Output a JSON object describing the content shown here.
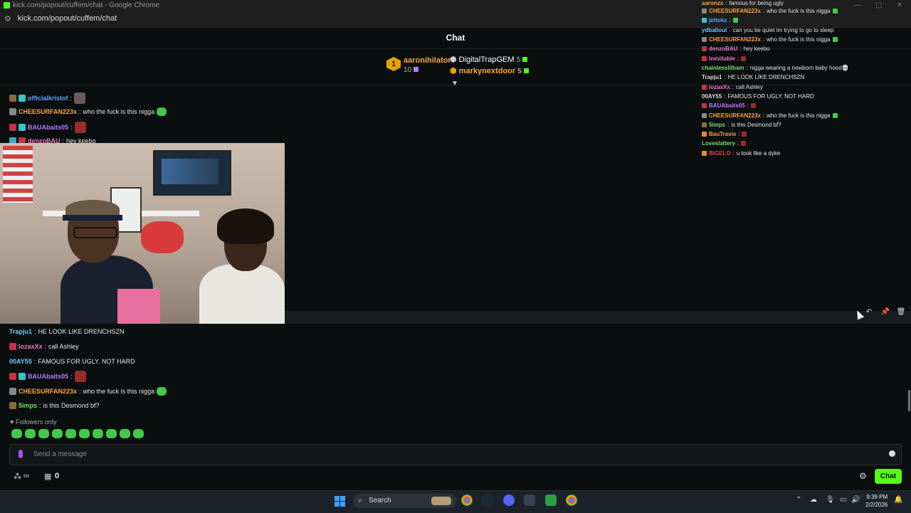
{
  "browser": {
    "window_title": "kick.com/popout/cuffem/chat - Google Chrome",
    "url": "kick.com/popout/cuffem/chat"
  },
  "chat": {
    "title": "Chat",
    "gifters": [
      {
        "rank": "1",
        "name": "aaronihilator",
        "count": "10"
      },
      {
        "name": "DigitalTrapGEM",
        "count": "5"
      },
      {
        "name": "markynextdoor",
        "count": "5"
      }
    ],
    "top_messages": [
      {
        "user": "officialkristof",
        "text": ""
      },
      {
        "user": "CHEESURFAN223x",
        "text": "who the fuck is this nigga"
      },
      {
        "user": "BAUAbaits05",
        "text": ""
      },
      {
        "user": "denzoBAU",
        "text": "hey keebo"
      }
    ],
    "bottom_messages": [
      {
        "user": "Trapju1",
        "text": "HE LOOK LIKE DRENCHSZN"
      },
      {
        "user": "lozaxXx",
        "text": "call Ashley"
      },
      {
        "user": "00AY55",
        "text": "FAMOUS FOR UGLY. NOT HARD"
      },
      {
        "user": "BAUAbaits05",
        "text": ""
      },
      {
        "user": "CHEESURFAN223x",
        "text": "who the fuck is this nigga"
      },
      {
        "user": "5imps",
        "text": "is this Desmond bf?"
      }
    ],
    "followers_only": "Followers only",
    "input_placeholder": "Send a message",
    "gift_count": "0",
    "send_button": "Chat"
  },
  "overlay_chat": [
    {
      "user": "aaronzx",
      "text": "famous for being ugly"
    },
    {
      "user": "CHEESURFAN223x",
      "text": "who the fuck is this nigga"
    },
    {
      "user": "jettokz",
      "text": ""
    },
    {
      "user": "ydballout",
      "text": "can you be quiet im trying to go to sleep"
    },
    {
      "user": "CHEESURFAN223x",
      "text": "who the fuck is this nigga"
    },
    {
      "user": "denzoBAU",
      "text": "hey keebo"
    },
    {
      "user": "inevitable",
      "text": ""
    },
    {
      "user": "chainlesslilbam",
      "text": "nigga wearing a newborn baby hood💀"
    },
    {
      "user": "Trapju1",
      "text": "HE LOOK LIKE DRENCHSZN"
    },
    {
      "user": "lozaxXx",
      "text": "call Ashley"
    },
    {
      "user": "00AY55",
      "text": "FAMOUS FOR UGLY. NOT HARD"
    },
    {
      "user": "BAUAbaits05",
      "text": ""
    },
    {
      "user": "CHEESURFAN223x",
      "text": "who the fuck is this nigga"
    },
    {
      "user": "5imps",
      "text": "is this Desmond bf?"
    },
    {
      "user": "BauTravis",
      "text": ""
    },
    {
      "user": "Loveslattery",
      "text": ""
    },
    {
      "user": "BIGELO",
      "text": "u look like a dyke"
    }
  ],
  "taskbar": {
    "search_label": "Search",
    "time": "9:39 PM",
    "date": "2/2/2026"
  },
  "colors": {
    "kick_green": "#53fc18",
    "background": "#0b0e0f"
  }
}
